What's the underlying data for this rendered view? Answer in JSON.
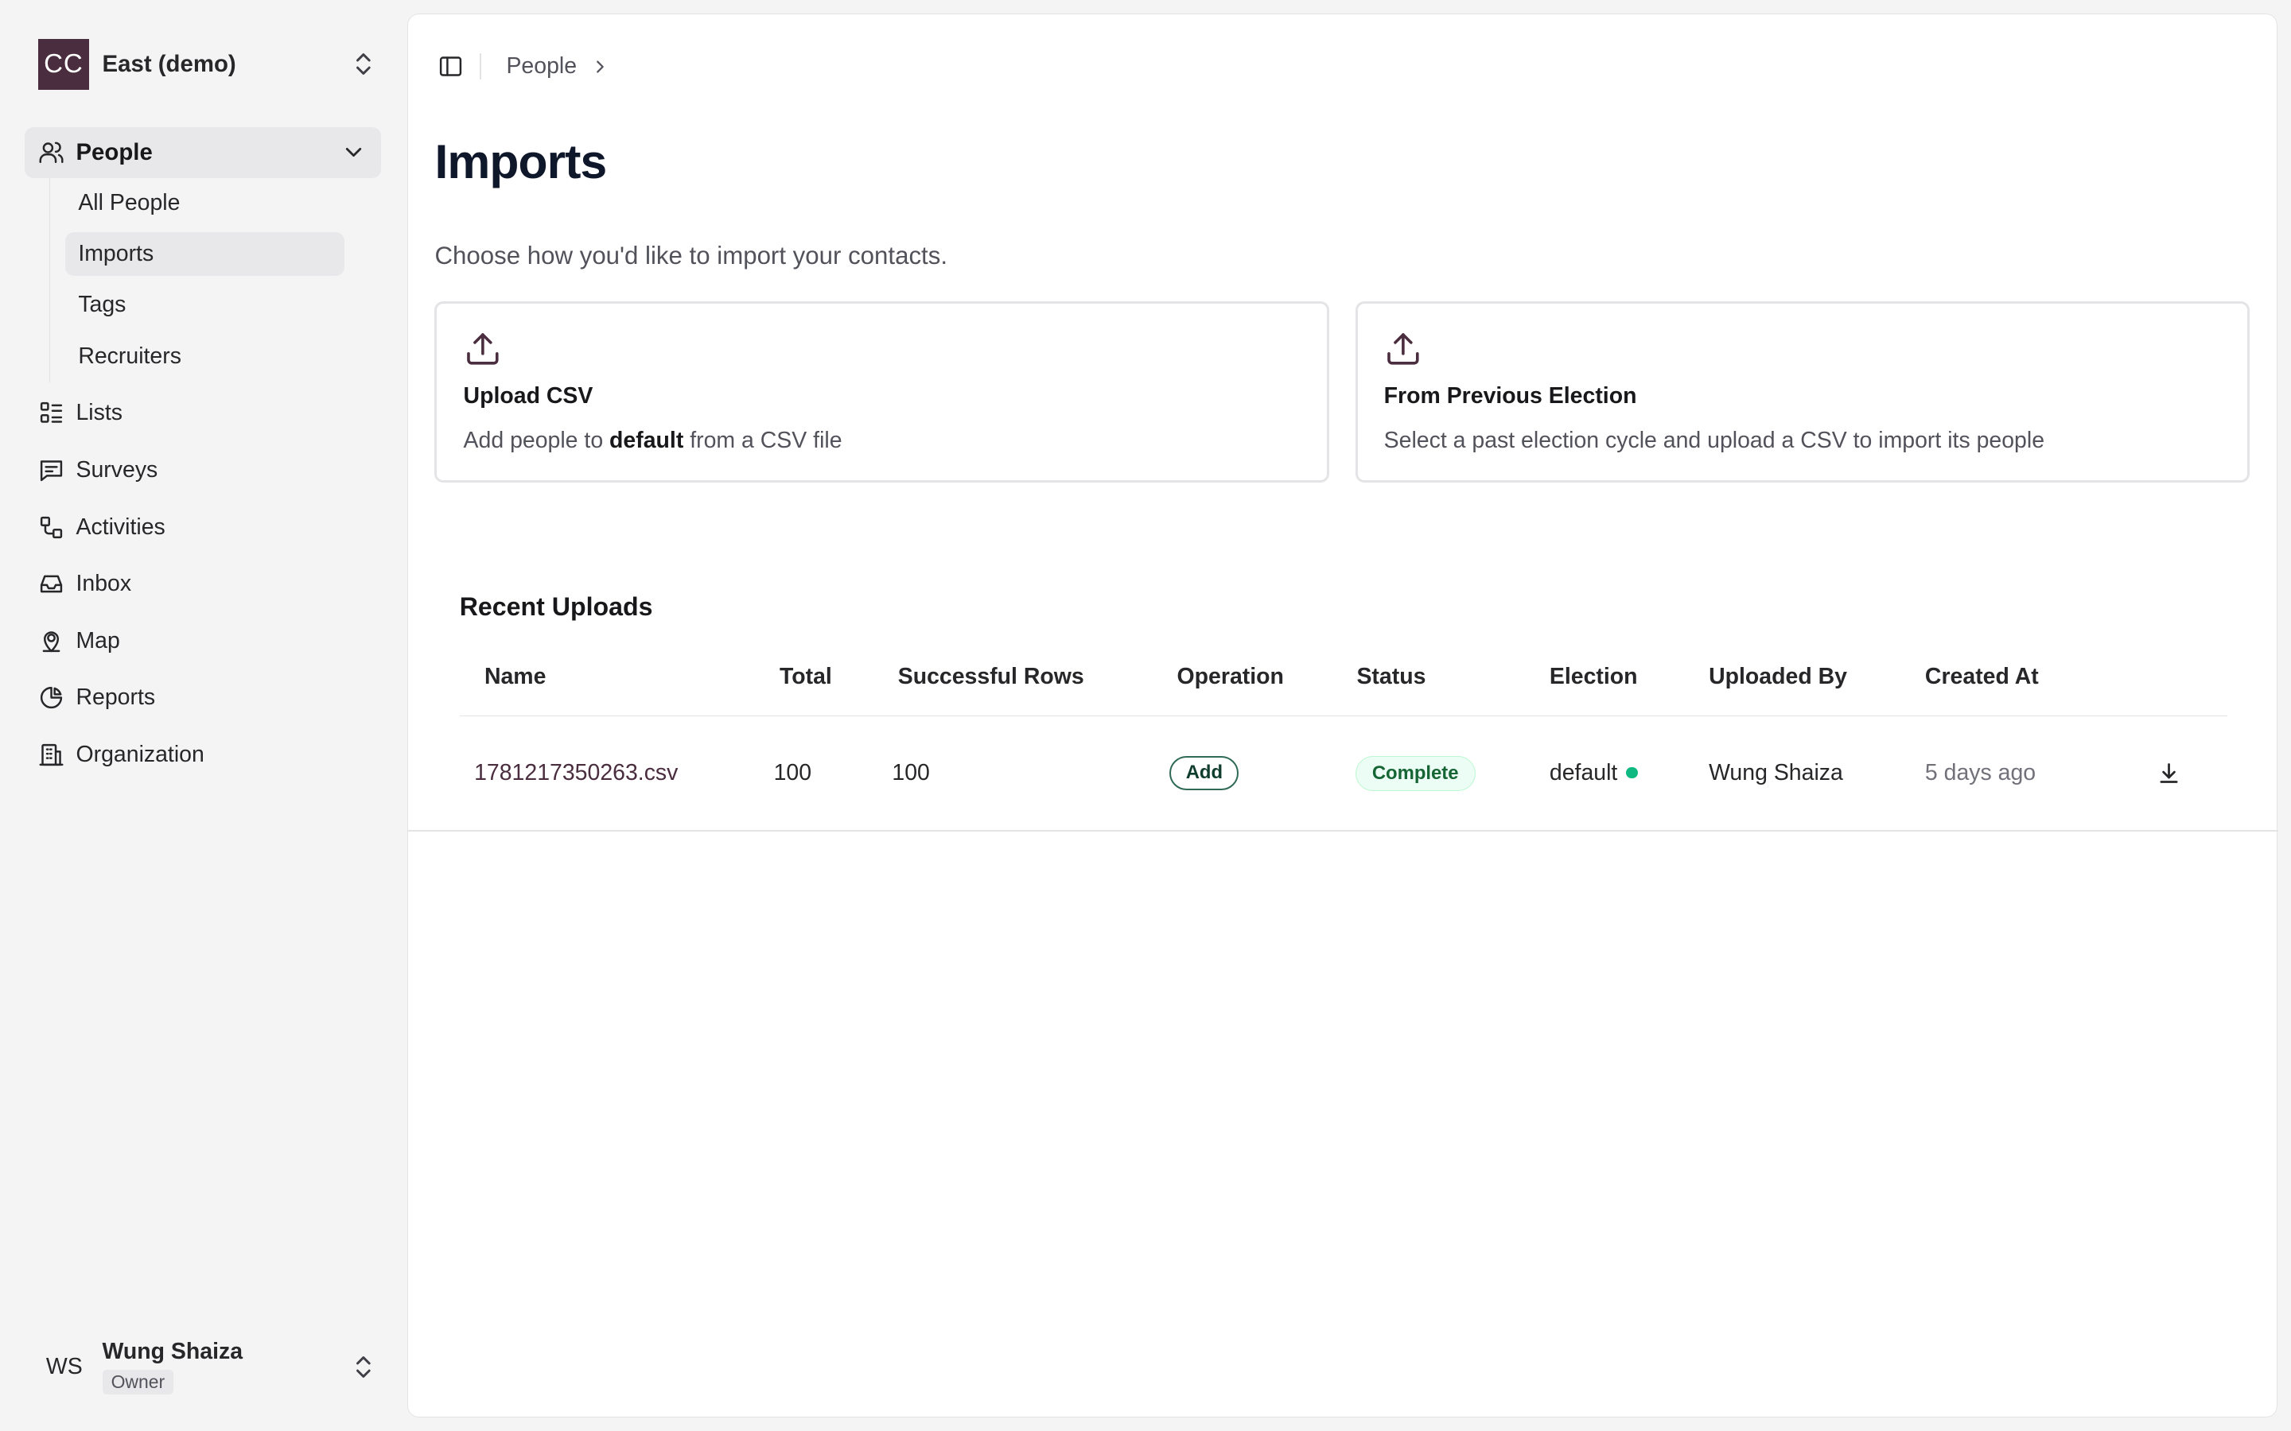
{
  "org": {
    "initials": "CC",
    "name": "East (demo)"
  },
  "sidebar": {
    "main": {
      "label": "People"
    },
    "sub": [
      {
        "label": "All People",
        "active": false
      },
      {
        "label": "Imports",
        "active": true
      },
      {
        "label": "Tags",
        "active": false
      },
      {
        "label": "Recruiters",
        "active": false
      }
    ],
    "items": [
      {
        "label": "Lists",
        "icon": "list-icon"
      },
      {
        "label": "Surveys",
        "icon": "survey-icon"
      },
      {
        "label": "Activities",
        "icon": "activities-icon"
      },
      {
        "label": "Inbox",
        "icon": "inbox-icon"
      },
      {
        "label": "Map",
        "icon": "map-pin-icon"
      },
      {
        "label": "Reports",
        "icon": "pie-chart-icon"
      },
      {
        "label": "Organization",
        "icon": "building-icon"
      }
    ]
  },
  "user": {
    "initials": "WS",
    "name": "Wung Shaiza",
    "role": "Owner"
  },
  "breadcrumb": {
    "item": "People"
  },
  "page": {
    "title": "Imports",
    "subtitle": "Choose how you'd like to import your contacts."
  },
  "cards": {
    "upload": {
      "title": "Upload CSV",
      "desc_before": "Add people to ",
      "desc_bold": "default",
      "desc_after": " from a CSV file"
    },
    "previous": {
      "title": "From Previous Election",
      "desc": "Select a past election cycle and upload a CSV to import its people"
    }
  },
  "recent": {
    "title": "Recent Uploads",
    "columns": [
      "Name",
      "Total",
      "Successful Rows",
      "Operation",
      "Status",
      "Election",
      "Uploaded By",
      "Created At"
    ],
    "rows": [
      {
        "name": "1781217350263.csv",
        "total": "100",
        "successful": "100",
        "operation": "Add",
        "status": "Complete",
        "election": "default",
        "uploaded_by": "Wung Shaiza",
        "created_at": "5 days ago"
      }
    ]
  },
  "colors": {
    "brand": "#4a2d3e",
    "success": "#10b981"
  }
}
